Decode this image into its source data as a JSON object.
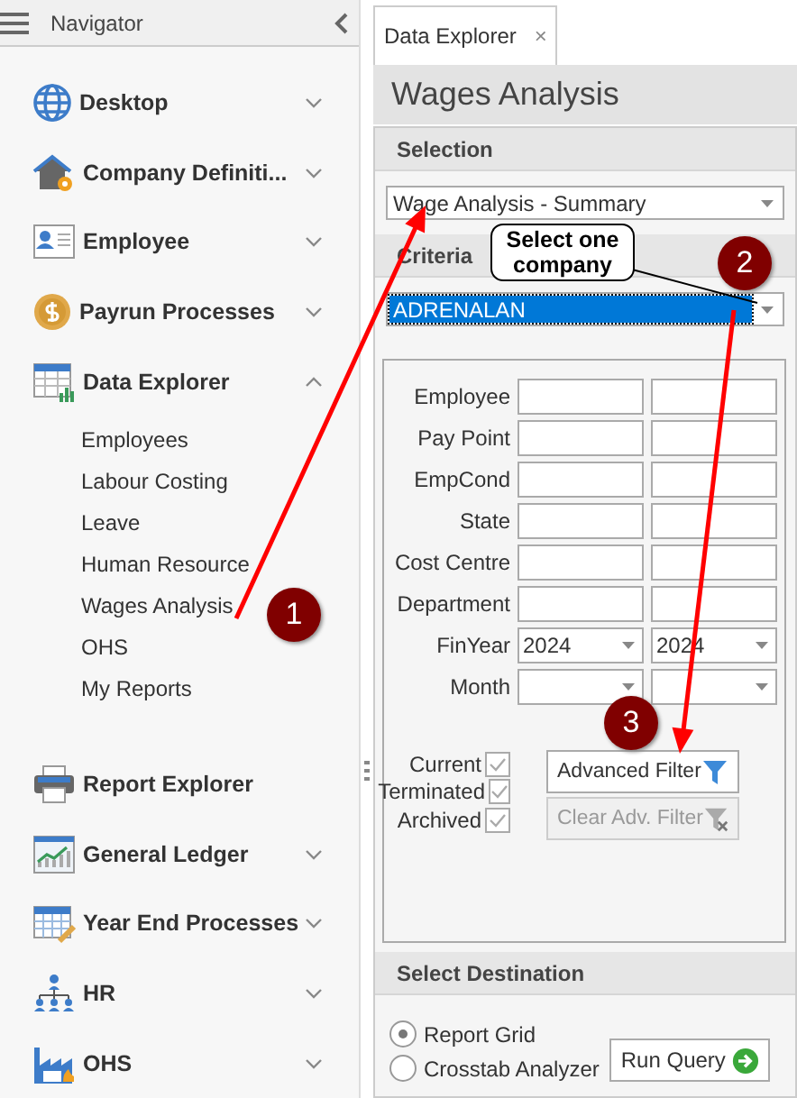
{
  "navigator": {
    "title": "Navigator",
    "items": [
      {
        "label": "Desktop",
        "expanded": false
      },
      {
        "label": "Company Definiti...",
        "expanded": false
      },
      {
        "label": "Employee",
        "expanded": false
      },
      {
        "label": "Payrun Processes",
        "expanded": false
      },
      {
        "label": "Data Explorer",
        "expanded": true,
        "children": [
          {
            "label": "Employees"
          },
          {
            "label": "Labour Costing"
          },
          {
            "label": "Leave"
          },
          {
            "label": "Human Resource"
          },
          {
            "label": "Wages Analysis"
          },
          {
            "label": "OHS"
          },
          {
            "label": "My Reports"
          }
        ]
      },
      {
        "label": "Report Explorer"
      },
      {
        "label": "General Ledger",
        "expanded": false
      },
      {
        "label": "Year End Processes",
        "expanded": false
      },
      {
        "label": "HR",
        "expanded": false
      },
      {
        "label": "OHS",
        "expanded": false
      }
    ]
  },
  "tab": {
    "label": "Data Explorer",
    "close": "×"
  },
  "title": "Wages Analysis",
  "selection": {
    "header": "Selection",
    "value": "Wage Analysis - Summary"
  },
  "criteria": {
    "header": "Criteria",
    "company": "ADRENALAN",
    "rows": [
      {
        "label": "Employee",
        "kind": "text"
      },
      {
        "label": "Pay Point",
        "kind": "text"
      },
      {
        "label": "EmpCond",
        "kind": "text"
      },
      {
        "label": "State",
        "kind": "text"
      },
      {
        "label": "Cost Centre",
        "kind": "text"
      },
      {
        "label": "Department",
        "kind": "text"
      },
      {
        "label": "FinYear",
        "kind": "select",
        "from": "2024",
        "to": "2024"
      },
      {
        "label": "Month",
        "kind": "select"
      }
    ],
    "checks": [
      {
        "label": "Current",
        "checked": true
      },
      {
        "label": "Terminated",
        "checked": true
      },
      {
        "label": "Archived",
        "checked": true
      }
    ],
    "buttons": [
      {
        "label": "Advanced Filter",
        "disabled": false
      },
      {
        "label": "Clear Adv. Filter",
        "disabled": true
      }
    ]
  },
  "destination": {
    "header": "Select Destination",
    "options": [
      {
        "label": "Report Grid",
        "selected": true
      },
      {
        "label": "Crosstab Analyzer",
        "selected": false
      }
    ],
    "run": "Run Query"
  },
  "annotations": [
    {
      "label": "1"
    },
    {
      "label": "2"
    },
    {
      "label": "3"
    }
  ],
  "callout": "Select one company"
}
